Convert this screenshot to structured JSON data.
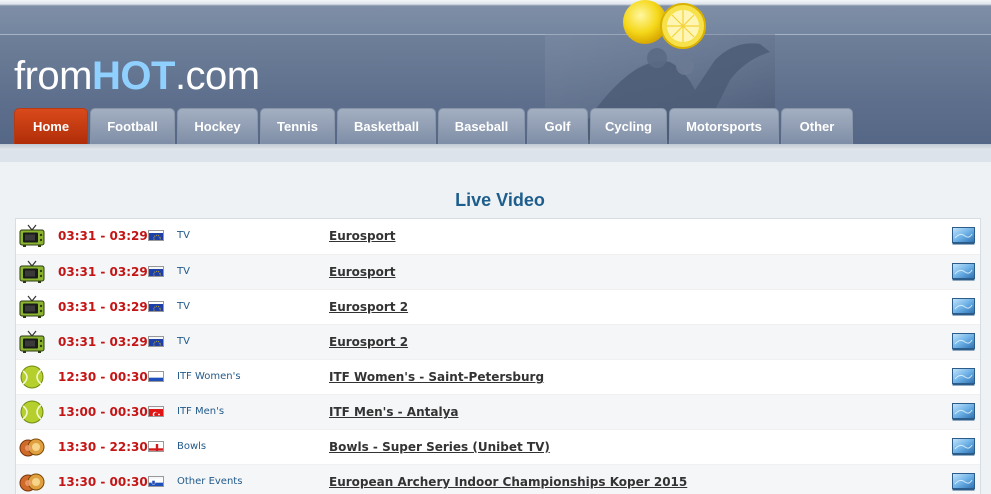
{
  "logo": {
    "part1": "from",
    "part2": "HOT",
    "part3": ".com"
  },
  "nav": [
    {
      "label": "Home",
      "name": "home",
      "active": true,
      "width": 74
    },
    {
      "label": "Football",
      "name": "football",
      "width": 85
    },
    {
      "label": "Hockey",
      "name": "hockey",
      "width": 81
    },
    {
      "label": "Tennis",
      "name": "tennis",
      "width": 75
    },
    {
      "label": "Basketball",
      "name": "basketball",
      "width": 99
    },
    {
      "label": "Baseball",
      "name": "baseball",
      "width": 87
    },
    {
      "label": "Golf",
      "name": "golf",
      "width": 61
    },
    {
      "label": "Cycling",
      "name": "cycling",
      "width": 77
    },
    {
      "label": "Motorsports",
      "name": "motorsports",
      "width": 110
    },
    {
      "label": "Other",
      "name": "other",
      "width": 72
    }
  ],
  "section_title": "Live Video",
  "rows": [
    {
      "icon": "tv-icon",
      "time": "03:31 - 03:29",
      "flag": "eu",
      "category": "TV",
      "event": "Eurosport"
    },
    {
      "icon": "tv-icon",
      "time": "03:31 - 03:29",
      "flag": "eu",
      "category": "TV",
      "event": "Eurosport"
    },
    {
      "icon": "tv-icon",
      "time": "03:31 - 03:29",
      "flag": "eu",
      "category": "TV",
      "event": "Eurosport 2"
    },
    {
      "icon": "tv-icon",
      "time": "03:31 - 03:29",
      "flag": "eu",
      "category": "TV",
      "event": "Eurosport 2"
    },
    {
      "icon": "tennis-ball-icon",
      "time": "12:30 - 00:30",
      "flag": "ru",
      "category": "ITF Women's",
      "event": "ITF Women's - Saint-Petersburg"
    },
    {
      "icon": "tennis-ball-icon",
      "time": "13:00 - 00:30",
      "flag": "tr",
      "category": "ITF Men's",
      "event": "ITF Men's - Antalya"
    },
    {
      "icon": "bowls-icon",
      "time": "13:30 - 22:30",
      "flag": "en",
      "category": "Bowls",
      "event": "Bowls - Super Series (Unibet TV)"
    },
    {
      "icon": "bowls-icon",
      "time": "13:30 - 00:30",
      "flag": "si",
      "category": "Other Events",
      "event": "European Archery Indoor Championships Koper 2015"
    }
  ],
  "colors": {
    "accent_tab": "#c23a10",
    "time_red": "#c41515",
    "title_blue": "#1e5e8c"
  }
}
